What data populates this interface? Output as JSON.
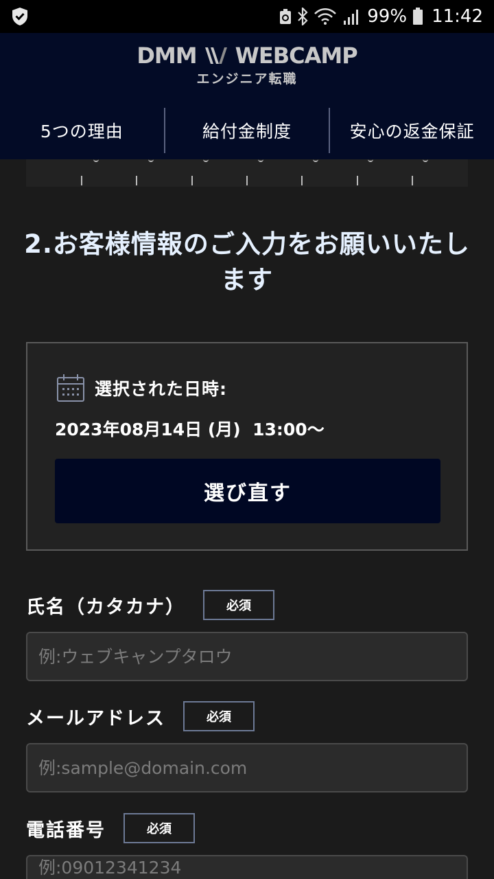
{
  "status_bar": {
    "battery": "99%",
    "time": "11:42",
    "icons": [
      "shield-check-icon",
      "recycle-icon",
      "bluetooth-icon",
      "wifi-icon",
      "signal-icon",
      "battery-icon"
    ]
  },
  "header": {
    "brand": "WEBCAMP",
    "brand_prefix": "DMM",
    "subtitle": "エンジニア転職"
  },
  "tabs": [
    {
      "label": "5つの理由"
    },
    {
      "label": "給付金制度"
    },
    {
      "label": "安心の返金保証"
    }
  ],
  "section": {
    "title": "2.お客様情報のご入力をお願いいたします"
  },
  "selected": {
    "label": "選択された日時:",
    "value": "2023年08月14日 (月)  13:00〜",
    "reselect_label": "選び直す"
  },
  "form": {
    "required_label": "必須",
    "fields": [
      {
        "label": "氏名（カタカナ）",
        "placeholder": "例:ウェブキャンプタロウ"
      },
      {
        "label": "メールアドレス",
        "placeholder": "例:sample@domain.com"
      },
      {
        "label": "電話番号",
        "placeholder": "例:09012341234"
      }
    ]
  },
  "colors": {
    "background": "#1b1b1b",
    "header": "#030b26",
    "button": "#000723",
    "title_text": "#e6f1ff"
  }
}
